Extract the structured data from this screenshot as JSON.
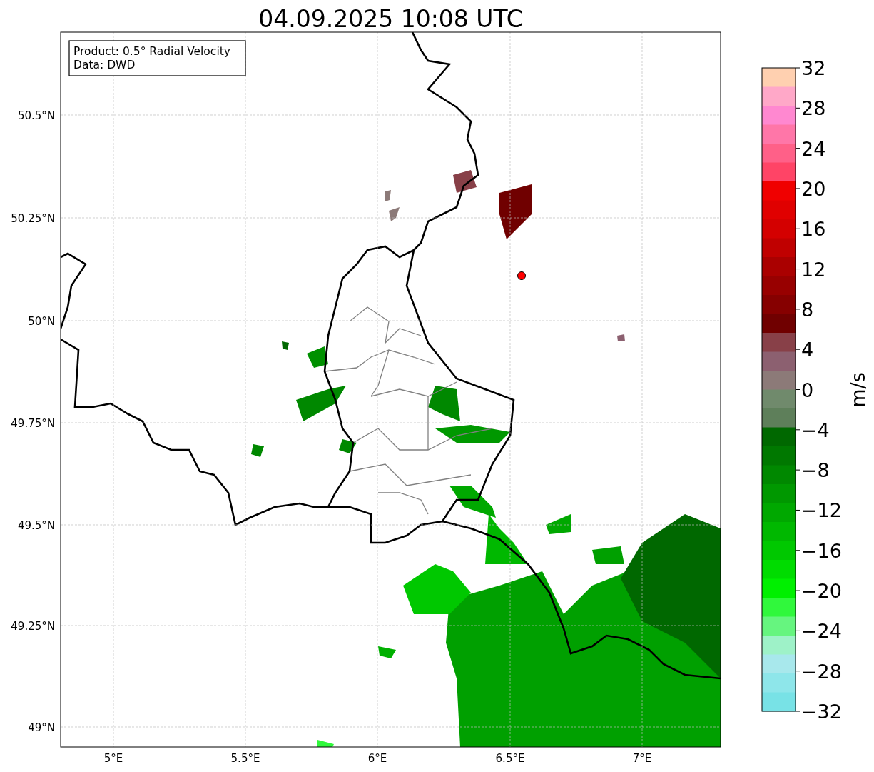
{
  "title": "04.09.2025 10:08 UTC",
  "info_box": [
    "Product: 0.5° Radial Velocity",
    "Data: DWD"
  ],
  "x_tick_labels": [
    "5°E",
    "5.5°E",
    "6°E",
    "6.5°E",
    "7°E"
  ],
  "y_tick_labels": [
    "50.5°N",
    "50.25°N",
    "50°N",
    "49.75°N",
    "49.5°N",
    "49.25°N",
    "49°N"
  ],
  "colorbar": {
    "label": "m/s",
    "tick_labels": [
      "32",
      "28",
      "24",
      "20",
      "16",
      "12",
      "8",
      "4",
      "0",
      "−4",
      "−8",
      "−12",
      "−16",
      "−20",
      "−24",
      "−28",
      "−32"
    ],
    "segments": [
      {
        "color": "#ffd0b0"
      },
      {
        "color": "#ffa8c8"
      },
      {
        "color": "#ff88d0"
      },
      {
        "color": "#ff76a8"
      },
      {
        "color": "#ff6088"
      },
      {
        "color": "#ff4466"
      },
      {
        "color": "#f00000"
      },
      {
        "color": "#e00000"
      },
      {
        "color": "#d40000"
      },
      {
        "color": "#c00000"
      },
      {
        "color": "#aa0000"
      },
      {
        "color": "#980000"
      },
      {
        "color": "#860000"
      },
      {
        "color": "#700000"
      },
      {
        "color": "#884048"
      },
      {
        "color": "#8c6070"
      },
      {
        "color": "#8c7a78"
      },
      {
        "color": "#708a6c"
      },
      {
        "color": "#5e7f5a"
      },
      {
        "color": "#006800"
      },
      {
        "color": "#007800"
      },
      {
        "color": "#008800"
      },
      {
        "color": "#009800"
      },
      {
        "color": "#00a800"
      },
      {
        "color": "#00b800"
      },
      {
        "color": "#00c800"
      },
      {
        "color": "#00dc00"
      },
      {
        "color": "#00f000"
      },
      {
        "color": "#30f83c"
      },
      {
        "color": "#66f57f"
      },
      {
        "color": "#9ef2c8"
      },
      {
        "color": "#a8e8ec"
      },
      {
        "color": "#8ee6ea"
      },
      {
        "color": "#78e2e6"
      }
    ]
  }
}
